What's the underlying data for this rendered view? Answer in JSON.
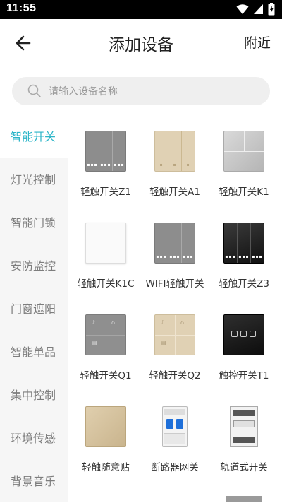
{
  "status": {
    "time": "11:55"
  },
  "header": {
    "title": "添加设备",
    "right_label": "附近"
  },
  "search": {
    "placeholder": "请输入设备名称"
  },
  "categories": [
    {
      "label": "智能开关",
      "active": true
    },
    {
      "label": "灯光控制",
      "active": false
    },
    {
      "label": "智能门锁",
      "active": false
    },
    {
      "label": "安防监控",
      "active": false
    },
    {
      "label": "门窗遮阳",
      "active": false
    },
    {
      "label": "智能单品",
      "active": false
    },
    {
      "label": "集中控制",
      "active": false
    },
    {
      "label": "环境传感",
      "active": false
    },
    {
      "label": "背景音乐",
      "active": false
    }
  ],
  "devices": [
    {
      "label": "轻触开关Z1",
      "icon": "gray-3gang-panel-icon"
    },
    {
      "label": "轻触开关A1",
      "icon": "gold-3gang-panel-icon"
    },
    {
      "label": "轻触开关K1",
      "icon": "silver-3gang-panel-icon"
    },
    {
      "label": "轻触开关K1C",
      "icon": "white-4gang-panel-icon"
    },
    {
      "label": "WIFI轻触开关",
      "icon": "gray-3gang-panel-icon"
    },
    {
      "label": "轻触开关Z3",
      "icon": "black-3gang-panel-icon"
    },
    {
      "label": "轻触开关Q1",
      "icon": "gray-scene-panel-icon"
    },
    {
      "label": "轻触开关Q2",
      "icon": "gold-scene-panel-icon"
    },
    {
      "label": "触控开关T1",
      "icon": "black-touch-panel-icon"
    },
    {
      "label": "轻触随意贴",
      "icon": "gold-2gang-panel-icon"
    },
    {
      "label": "断路器网关",
      "icon": "circuit-breaker-icon"
    },
    {
      "label": "轨道式开关",
      "icon": "din-rail-switch-icon"
    }
  ],
  "colors": {
    "accent": "#2bb5c8",
    "sidebar_bg": "#f6f6f6",
    "search_bg": "#efefef"
  }
}
